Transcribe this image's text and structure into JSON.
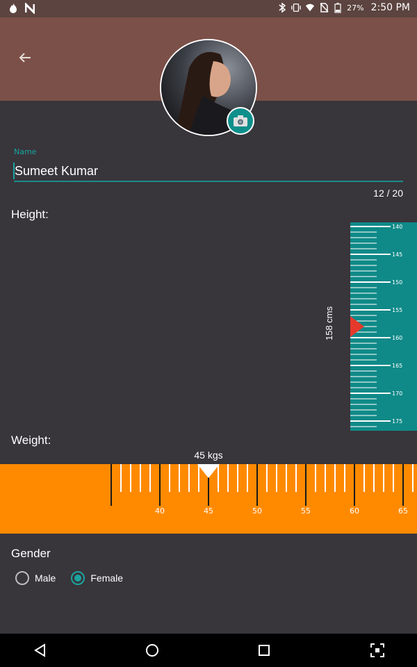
{
  "status_bar": {
    "battery_percent": "27%",
    "time": "2:50 PM",
    "icons": [
      "fire-icon",
      "n-icon",
      "bluetooth-icon",
      "vibrate-icon",
      "wifi-icon",
      "no-sim-icon",
      "battery-icon"
    ]
  },
  "header": {
    "back_icon": "back-arrow-icon",
    "camera_icon": "camera-icon",
    "brand_color": "#7b5048"
  },
  "name_field": {
    "label": "Name",
    "value": "Sumeet Kumar",
    "counter": "12 / 20"
  },
  "height": {
    "label": "Height:",
    "readout": "158 cms",
    "value_cm": 158,
    "ticks": [
      "140",
      "145",
      "150",
      "155",
      "160",
      "165",
      "170",
      "175"
    ],
    "color": "#0f8a88"
  },
  "weight": {
    "label": "Weight:",
    "readout": "45 kgs",
    "value_kg": 45,
    "ticks": [
      "40",
      "45",
      "50",
      "55",
      "60",
      "65"
    ],
    "color": "#ff8a00"
  },
  "gender": {
    "label": "Gender",
    "options": [
      "Male",
      "Female"
    ],
    "selected": "Female"
  },
  "nav_bar": {
    "icons": [
      "back-triangle-icon",
      "home-circle-icon",
      "recents-square-icon",
      "screenshot-icon"
    ]
  }
}
